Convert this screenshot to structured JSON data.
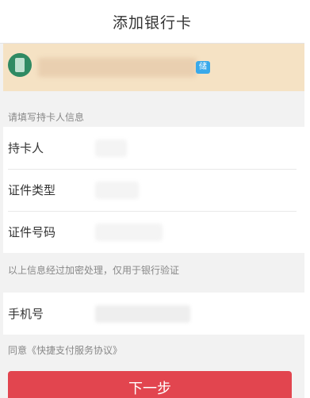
{
  "nav": {
    "title": "添加银行卡"
  },
  "notice": {
    "tag_text": "储"
  },
  "section": {
    "cardholder_info_label": "请填写持卡人信息"
  },
  "form": {
    "fields": [
      {
        "label": "持卡人"
      },
      {
        "label": "证件类型"
      },
      {
        "label": "证件号码"
      }
    ],
    "phone_label": "手机号"
  },
  "notes": {
    "encryption": "以上信息经过加密处理，仅用于银行验证",
    "agreement": "同意《快捷支付服务协议》"
  },
  "actions": {
    "next_label": "下一步"
  },
  "colors": {
    "primary": "#e2454f",
    "notice_bg": "#f5e2c4",
    "tag": "#39a9ea",
    "bank_logo": "#2f8a63"
  }
}
